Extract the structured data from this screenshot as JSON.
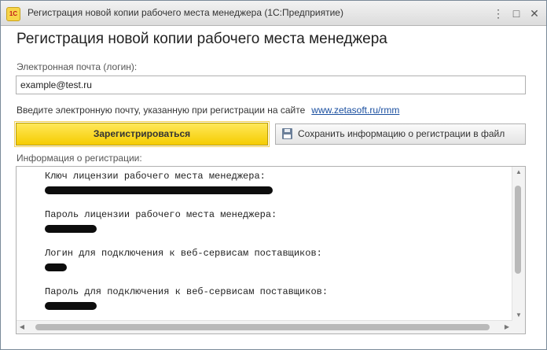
{
  "window": {
    "app_icon_text": "1C",
    "title": "Регистрация новой копии рабочего места менеджера  (1С:Предприятие)",
    "controls": [
      "⋮",
      "□",
      "✕"
    ]
  },
  "form": {
    "heading": "Регистрация новой копии рабочего места менеджера",
    "email_label": "Электронная почта (логин):",
    "email_value": "example@test.ru",
    "hint_text": "Введите электронную почту, указанную при регистрации на сайте",
    "hint_link": "www.zetasoft.ru/rmm",
    "register_button": "Зарегистрироваться",
    "save_button": "Сохранить информацию о регистрации в файл",
    "info_label": "Информация о регистрации:",
    "info_lines": [
      "Ключ лицензии рабочего места менеджера:",
      "Пароль лицензии рабочего места менеджера:",
      "Логин для подключения к веб-сервисам поставщиков:",
      "Пароль для подключения к веб-сервисам поставщиков:"
    ]
  },
  "scrollbars": {
    "up": "▲",
    "down": "▼",
    "left": "◀",
    "right": "▶"
  }
}
